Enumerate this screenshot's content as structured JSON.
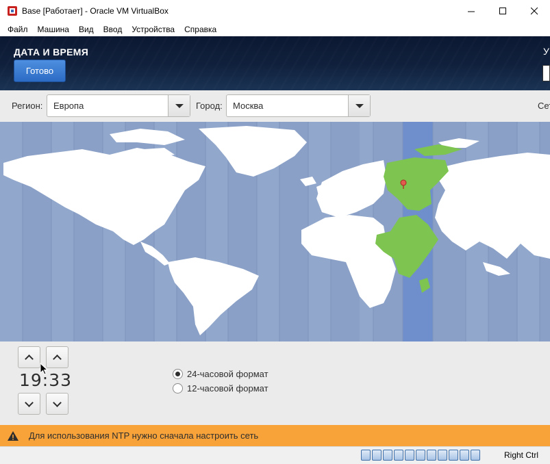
{
  "window": {
    "title": "Base [Работает] - Oracle VM VirtualBox",
    "minimize_icon": "minimize-icon",
    "maximize_icon": "maximize-icon",
    "close_icon": "close-icon"
  },
  "menu": [
    "Файл",
    "Машина",
    "Вид",
    "Ввод",
    "Устройства",
    "Справка"
  ],
  "header": {
    "title": "ДАТА И ВРЕМЯ",
    "done_label": "Готово",
    "cut_letter": "У"
  },
  "region_bar": {
    "region_label": "Регион:",
    "region_value": "Европа",
    "city_label": "Город:",
    "city_value": "Москва",
    "cut_text": "Сет"
  },
  "time": {
    "value": "19:33"
  },
  "format": {
    "option_24": "24-часовой формат",
    "option_12": "12-часовой формат",
    "selected": "24"
  },
  "warning": {
    "text": "Для использования NTP нужно сначала настроить сеть"
  },
  "statusbar": {
    "host_key": "Right Ctrl"
  },
  "colors": {
    "header_bg": "#10213d",
    "accent": "#2b6bc4",
    "map_ocean": "#8aa0c6",
    "map_land": "#ffffff",
    "map_highlight": "#7dc550",
    "warning_bg": "#f8a339"
  }
}
